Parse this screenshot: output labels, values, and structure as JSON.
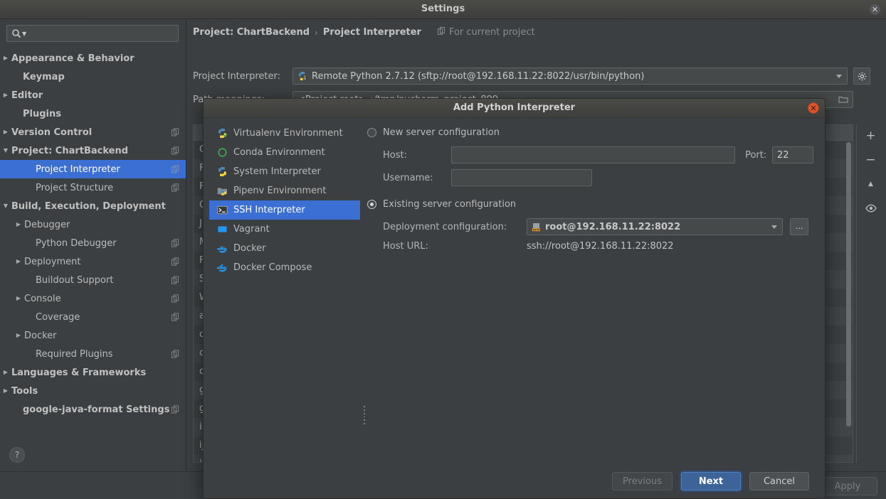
{
  "window": {
    "title": "Settings",
    "close_icon": "close-icon"
  },
  "search": {
    "placeholder": "",
    "value": "",
    "icon": "search-icon"
  },
  "sidebar": {
    "items": [
      {
        "label": "Appearance & Behavior",
        "arrow": "▶",
        "bold": true,
        "indent": 6,
        "badge": false,
        "selected": false
      },
      {
        "label": "Keymap",
        "arrow": "",
        "bold": true,
        "indent": 22,
        "badge": false,
        "selected": false
      },
      {
        "label": "Editor",
        "arrow": "▶",
        "bold": true,
        "indent": 6,
        "badge": false,
        "selected": false
      },
      {
        "label": "Plugins",
        "arrow": "",
        "bold": true,
        "indent": 22,
        "badge": false,
        "selected": false
      },
      {
        "label": "Version Control",
        "arrow": "▶",
        "bold": true,
        "indent": 6,
        "badge": true,
        "selected": false
      },
      {
        "label": "Project: ChartBackend",
        "arrow": "▼",
        "bold": true,
        "indent": 6,
        "badge": true,
        "selected": false
      },
      {
        "label": "Project Interpreter",
        "arrow": "",
        "bold": false,
        "indent": 40,
        "badge": true,
        "selected": true
      },
      {
        "label": "Project Structure",
        "arrow": "",
        "bold": false,
        "indent": 40,
        "badge": true,
        "selected": false
      },
      {
        "label": "Build, Execution, Deployment",
        "arrow": "▼",
        "bold": true,
        "indent": 6,
        "badge": false,
        "selected": false
      },
      {
        "label": "Debugger",
        "arrow": "▶",
        "bold": false,
        "indent": 24,
        "badge": false,
        "selected": false
      },
      {
        "label": "Python Debugger",
        "arrow": "",
        "bold": false,
        "indent": 40,
        "badge": true,
        "selected": false
      },
      {
        "label": "Deployment",
        "arrow": "▶",
        "bold": false,
        "indent": 24,
        "badge": true,
        "selected": false
      },
      {
        "label": "Buildout Support",
        "arrow": "",
        "bold": false,
        "indent": 40,
        "badge": true,
        "selected": false
      },
      {
        "label": "Console",
        "arrow": "▶",
        "bold": false,
        "indent": 24,
        "badge": true,
        "selected": false
      },
      {
        "label": "Coverage",
        "arrow": "",
        "bold": false,
        "indent": 40,
        "badge": true,
        "selected": false
      },
      {
        "label": "Docker",
        "arrow": "▶",
        "bold": false,
        "indent": 24,
        "badge": false,
        "selected": false
      },
      {
        "label": "Required Plugins",
        "arrow": "",
        "bold": false,
        "indent": 40,
        "badge": true,
        "selected": false
      },
      {
        "label": "Languages & Frameworks",
        "arrow": "▶",
        "bold": true,
        "indent": 6,
        "badge": false,
        "selected": false
      },
      {
        "label": "Tools",
        "arrow": "▶",
        "bold": true,
        "indent": 6,
        "badge": false,
        "selected": false
      },
      {
        "label": "google-java-format Settings",
        "arrow": "",
        "bold": true,
        "indent": 22,
        "badge": true,
        "selected": false
      }
    ],
    "help_label": "?"
  },
  "main": {
    "breadcrumb": {
      "project": "Project: ChartBackend",
      "separator": "›",
      "page": "Project Interpreter",
      "scope_note": "For current project"
    },
    "interpreter_row": {
      "label": "Project Interpreter:",
      "value": "Remote Python 2.7.12 (sftp://root@192.168.11.22:8022/usr/bin/python)",
      "gear_icon": "gear-icon",
      "dropdown_icon": "chevron-down-icon"
    },
    "path_mappings_row": {
      "label": "Path mappings:",
      "value": "<Project root>→/tmp/pycharm_project_899",
      "browse_icon": "folder-icon"
    },
    "package_rows": [
      "C",
      "F",
      "F",
      "C",
      "J",
      "M",
      "F",
      "S",
      "W",
      "a",
      "c",
      "c",
      "c",
      "g",
      "g",
      "i",
      "ij",
      "il"
    ],
    "toolbar": {
      "add": "+",
      "remove": "−",
      "upgrade": "▲",
      "show_early": "eye-icon"
    }
  },
  "dialog": {
    "title": "Add Python Interpreter",
    "close_icon": "close-icon",
    "env_types": [
      {
        "label": "Virtualenv Environment",
        "icon": "python-venv-icon",
        "selected": false
      },
      {
        "label": "Conda Environment",
        "icon": "conda-icon",
        "selected": false
      },
      {
        "label": "System Interpreter",
        "icon": "python-icon",
        "selected": false
      },
      {
        "label": "Pipenv Environment",
        "icon": "pipenv-icon",
        "selected": false
      },
      {
        "label": "SSH Interpreter",
        "icon": "terminal-icon",
        "selected": true
      },
      {
        "label": "Vagrant",
        "icon": "vagrant-icon",
        "selected": false
      },
      {
        "label": "Docker",
        "icon": "docker-icon",
        "selected": false
      },
      {
        "label": "Docker Compose",
        "icon": "docker-compose-icon",
        "selected": false
      }
    ],
    "new_server": {
      "radio_label": "New server configuration",
      "selected": false,
      "host_label": "Host:",
      "host_value": "",
      "port_label": "Port:",
      "port_value": "22",
      "username_label": "Username:",
      "username_value": ""
    },
    "existing_server": {
      "radio_label": "Existing server configuration",
      "selected": true,
      "deployment_label": "Deployment configuration:",
      "deployment_value": "root@192.168.11.22:8022",
      "deployment_icon": "sftp-server-icon",
      "browse_label": "...",
      "host_url_label": "Host URL:",
      "host_url_value": "ssh://root@192.168.11.22:8022"
    },
    "buttons": {
      "previous": "Previous",
      "next": "Next",
      "cancel": "Cancel"
    }
  },
  "footer": {
    "apply": "Apply"
  },
  "colors": {
    "accent_blue": "#3b6fd4",
    "dialog_bg": "#3c3f41",
    "primary_button": "#3c6498",
    "close_red": "#d9552f"
  }
}
